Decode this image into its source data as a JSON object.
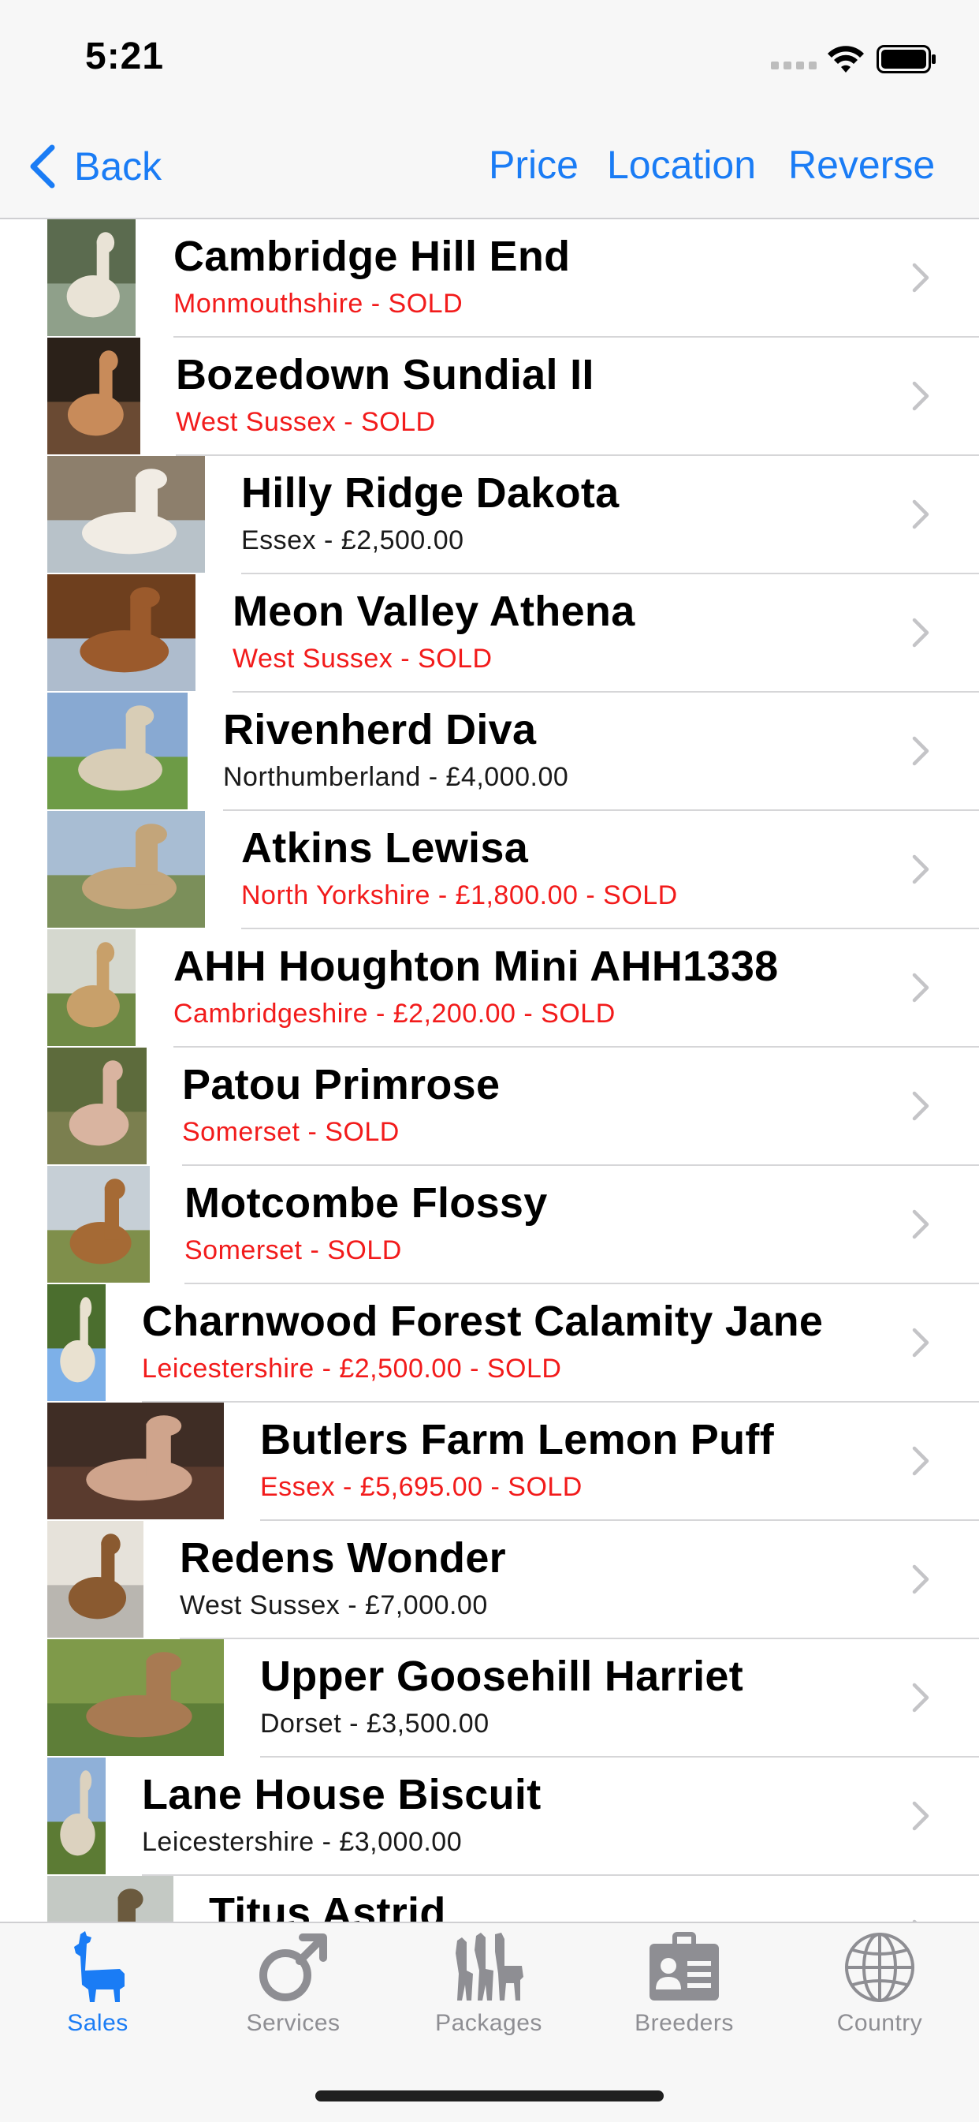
{
  "status_bar": {
    "time": "5:21"
  },
  "nav": {
    "back_label": "Back",
    "actions": {
      "price": "Price",
      "location": "Location",
      "reverse": "Reverse"
    }
  },
  "colors": {
    "accent": "#1a7cf5",
    "sold": "#f21b1b",
    "inactive": "#8e8e93"
  },
  "listings": [
    {
      "name": "Cambridge Hill End",
      "subtitle": "Monmouthshire - SOLD",
      "status": "sold"
    },
    {
      "name": "Bozedown Sundial II",
      "subtitle": "West Sussex - SOLD",
      "status": "sold"
    },
    {
      "name": "Hilly Ridge Dakota",
      "subtitle": "Essex - £2,500.00",
      "status": "available"
    },
    {
      "name": "Meon Valley Athena",
      "subtitle": "West Sussex - SOLD",
      "status": "sold"
    },
    {
      "name": "Rivenherd Diva",
      "subtitle": "Northumberland - £4,000.00",
      "status": "available"
    },
    {
      "name": "Atkins Lewisa",
      "subtitle": "North Yorkshire - £1,800.00 - SOLD",
      "status": "sold"
    },
    {
      "name": "AHH Houghton Mini AHH1338",
      "subtitle": "Cambridgeshire - £2,200.00 - SOLD",
      "status": "sold"
    },
    {
      "name": "Patou Primrose",
      "subtitle": "Somerset - SOLD",
      "status": "sold"
    },
    {
      "name": "Motcombe Flossy",
      "subtitle": "Somerset - SOLD",
      "status": "sold"
    },
    {
      "name": "Charnwood Forest Calamity Jane",
      "subtitle": "Leicestershire - £2,500.00 - SOLD",
      "status": "sold"
    },
    {
      "name": "Butlers Farm Lemon Puff",
      "subtitle": "Essex - £5,695.00 - SOLD",
      "status": "sold"
    },
    {
      "name": "Redens Wonder",
      "subtitle": "West Sussex - £7,000.00",
      "status": "available"
    },
    {
      "name": "Upper Goosehill Harriet",
      "subtitle": "Dorset - £3,500.00",
      "status": "available"
    },
    {
      "name": "Lane House Biscuit",
      "subtitle": "Leicestershire - £3,000.00",
      "status": "available"
    },
    {
      "name": "Titus Astrid",
      "subtitle": "",
      "status": "available"
    }
  ],
  "tabs": [
    {
      "label": "Sales",
      "icon": "alpaca-icon",
      "active": true
    },
    {
      "label": "Services",
      "icon": "male-symbol-icon",
      "active": false
    },
    {
      "label": "Packages",
      "icon": "alpaca-herd-icon",
      "active": false
    },
    {
      "label": "Breeders",
      "icon": "id-card-icon",
      "active": false
    },
    {
      "label": "Country",
      "icon": "globe-icon",
      "active": false
    }
  ]
}
